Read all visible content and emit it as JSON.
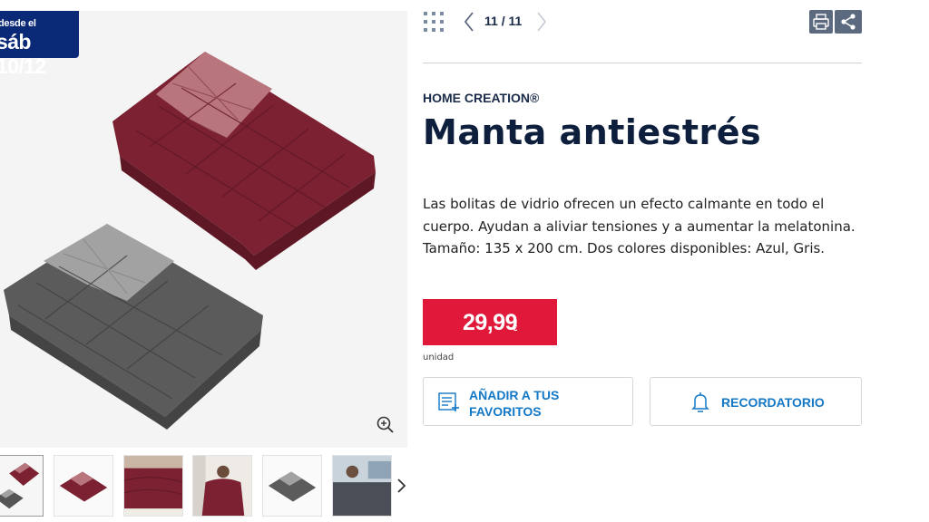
{
  "badge": {
    "line1": "desde el",
    "line2": "sáb 10/12"
  },
  "gallery": {
    "thumbnails": [
      {
        "name": "thumb-two-blankets"
      },
      {
        "name": "thumb-red-blanket"
      },
      {
        "name": "thumb-blanket-on-bed"
      },
      {
        "name": "thumb-woman-with-blanket"
      },
      {
        "name": "thumb-grey-blanket"
      },
      {
        "name": "thumb-man-with-blanket"
      }
    ]
  },
  "nav": {
    "pager": "11 / 11"
  },
  "product": {
    "brand": "HOME CREATION®",
    "title": "Manta antiestrés",
    "description": "Las bolitas de vidrio ofrecen un efecto calmante en todo el cuerpo. Ayudan a aliviar tensiones y a aumentar la melatonina. Tamaño: 135 x 200 cm. Dos colores disponibles: Azul, Gris.",
    "price": "29,99",
    "currency": "€",
    "unit": "unidad"
  },
  "actions": {
    "favorites_label": "Añadir a tus favoritos",
    "reminder_label": "RECORDATORIO"
  },
  "colors": {
    "badge_bg": "#0a2a78",
    "price_bg": "#e0193a",
    "action_text": "#1378c6",
    "title": "#0d1f3c",
    "icon_button_bg": "#5b6a7f"
  },
  "icons": [
    "zoom-in-icon",
    "grid-icon",
    "chevron-left-icon",
    "chevron-right-icon",
    "print-icon",
    "share-icon",
    "list-add-icon",
    "bell-icon"
  ]
}
